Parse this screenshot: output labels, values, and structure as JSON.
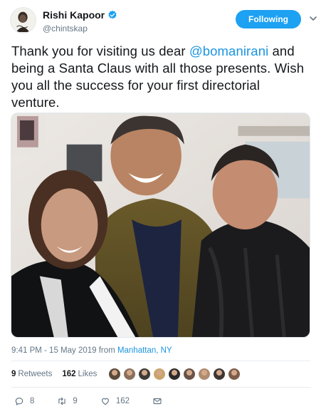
{
  "author": {
    "display_name": "Rishi Kapoor",
    "handle": "@chintskap",
    "verified": true,
    "follow_label": "Following"
  },
  "tweet": {
    "text_before": "Thank you for visiting us dear ",
    "mention": "@bomanirani",
    "text_after": " and being a Santa Claus with all those presents. Wish you all the success for your first directorial venture.",
    "timestamp": "9:41 PM - 15 May 2019 from ",
    "location": "Manhattan, NY"
  },
  "stats": {
    "retweets_count": "9",
    "retweets_label": "Retweets",
    "likes_count": "162",
    "likes_label": "Likes"
  },
  "actions": {
    "reply_count": "8",
    "retweet_count": "9",
    "like_count": "162"
  },
  "liker_avatar_colors": [
    "#5a4a3c",
    "#8a6f5c",
    "#3e3a36",
    "#c9a46b",
    "#2e2b2a",
    "#6b5246",
    "#b08b6e",
    "#403633",
    "#7d5d4a"
  ],
  "colors": {
    "accent": "#1da1f2",
    "link": "#1b95e0",
    "text": "#14171a",
    "muted": "#657786"
  },
  "icons": {
    "verified": "verified-badge-icon",
    "chevron": "chevron-down-icon",
    "reply": "reply-icon",
    "retweet": "retweet-icon",
    "like": "heart-icon",
    "message": "envelope-icon"
  }
}
